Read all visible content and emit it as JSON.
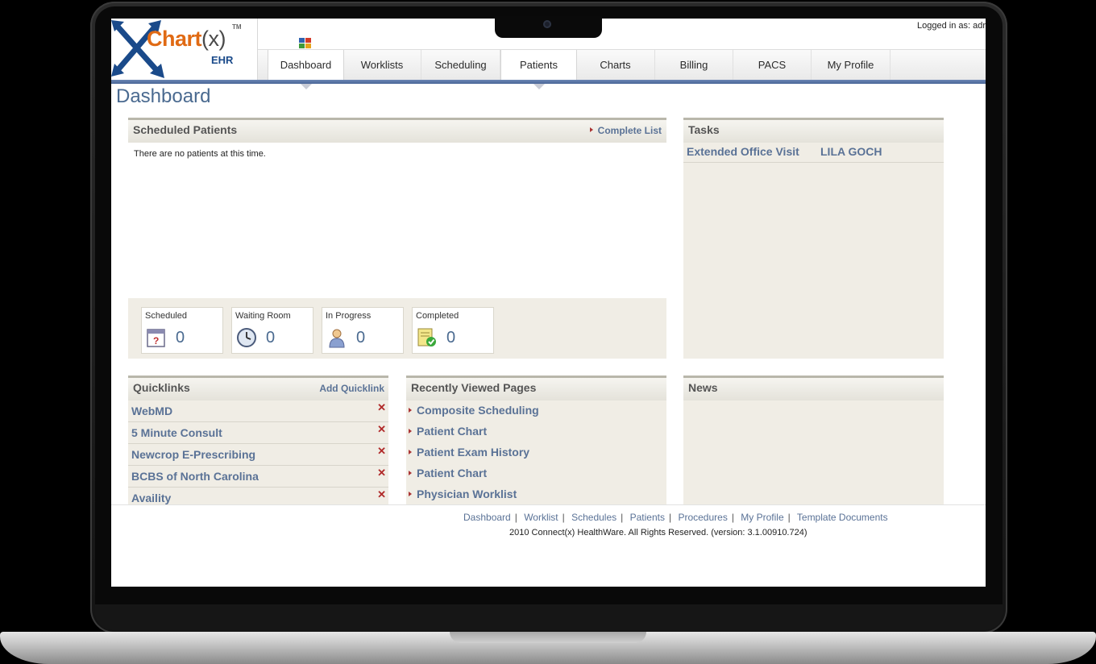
{
  "header": {
    "logo_main": "Chart",
    "logo_paren": "(x)",
    "logo_tm": "TM",
    "logo_sub": "EHR",
    "logged_in": "Logged in as: adr"
  },
  "tabs": [
    {
      "label": "Dashboard"
    },
    {
      "label": "Worklists"
    },
    {
      "label": "Scheduling"
    },
    {
      "label": "Patients"
    },
    {
      "label": "Charts"
    },
    {
      "label": "Billing"
    },
    {
      "label": "PACS"
    },
    {
      "label": "My Profile"
    }
  ],
  "page_title": "Dashboard",
  "scheduled_patients": {
    "title": "Scheduled Patients",
    "link": "Complete List",
    "empty_text": "There are no patients at this time.",
    "stats": [
      {
        "label": "Scheduled",
        "count": "0",
        "icon": "calendar-icon"
      },
      {
        "label": "Waiting Room",
        "count": "0",
        "icon": "clock-icon"
      },
      {
        "label": "In Progress",
        "count": "0",
        "icon": "person-icon"
      },
      {
        "label": "Completed",
        "count": "0",
        "icon": "check-document-icon"
      }
    ]
  },
  "tasks": {
    "title": "Tasks",
    "items": [
      {
        "type": "Extended Office Visit",
        "patient": "LILA GOCH"
      }
    ]
  },
  "quicklinks": {
    "title": "Quicklinks",
    "add_label": "Add Quicklink",
    "remove_symbol": "✕",
    "items": [
      {
        "label": "WebMD"
      },
      {
        "label": "5 Minute Consult"
      },
      {
        "label": "Newcrop E-Prescribing"
      },
      {
        "label": "BCBS of North Carolina"
      },
      {
        "label": "Availity"
      }
    ]
  },
  "recently_viewed": {
    "title": "Recently Viewed Pages",
    "items": [
      {
        "label": "Composite Scheduling"
      },
      {
        "label": "Patient Chart"
      },
      {
        "label": "Patient Exam History"
      },
      {
        "label": "Patient Chart"
      },
      {
        "label": "Physician Worklist"
      }
    ]
  },
  "news": {
    "title": "News"
  },
  "footer": {
    "links": [
      "Dashboard",
      "Worklist",
      "Schedules",
      "Patients",
      "Procedures",
      "My Profile",
      "Template Documents"
    ],
    "separator": "|",
    "copyright": "2010 Connect(x) HealthWare. All Rights Reserved. (version: 3.1.00910.724)"
  },
  "colors": {
    "accent_blue": "#4a6698",
    "link_blue": "#5a7296",
    "logo_orange": "#e06a14",
    "panel_bg": "#f0ede5",
    "remove_red": "#b02a2a"
  }
}
